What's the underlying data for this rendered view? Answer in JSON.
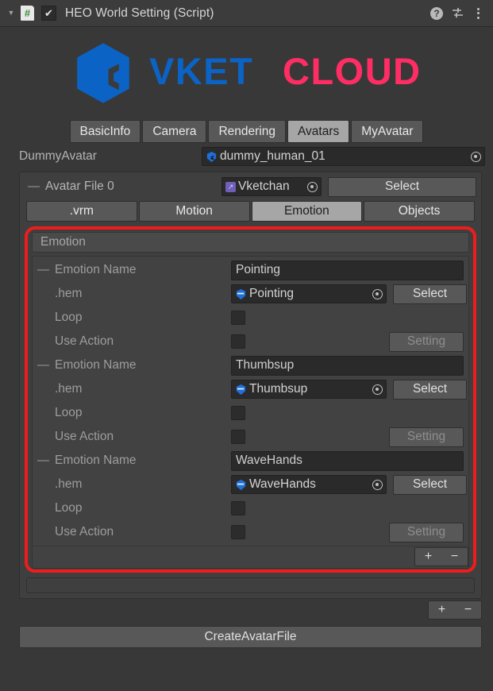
{
  "header": {
    "title": "HEO World Setting (Script)",
    "foldout_glyph": "▼",
    "script_icon_glyph": "#",
    "enabled_check_glyph": "✔",
    "help_glyph": "?"
  },
  "logo": {
    "brand_first": "VKET",
    "brand_second": "CLOUD",
    "blue": "#0B63C6",
    "pink": "#FF2D63"
  },
  "tabs": [
    {
      "label": "BasicInfo",
      "selected": false
    },
    {
      "label": "Camera",
      "selected": false
    },
    {
      "label": "Rendering",
      "selected": false
    },
    {
      "label": "Avatars",
      "selected": true
    },
    {
      "label": "MyAvatar",
      "selected": false
    }
  ],
  "dummy_avatar": {
    "label": "DummyAvatar",
    "value": "dummy_human_01"
  },
  "avatar_file": {
    "label": "Avatar File 0",
    "object_value": "Vketchan",
    "select_label": "Select"
  },
  "subtabs": [
    {
      "label": ".vrm",
      "selected": false
    },
    {
      "label": "Motion",
      "selected": false
    },
    {
      "label": "Emotion",
      "selected": true
    },
    {
      "label": "Objects",
      "selected": false
    }
  ],
  "emotion_section": {
    "title": "Emotion",
    "row_labels": {
      "name": "Emotion Name",
      "hem": ".hem",
      "loop": "Loop",
      "use_action": "Use Action"
    },
    "select_label": "Select",
    "setting_label": "Setting",
    "add_label": "+",
    "remove_label": "−",
    "highlight_color": "#ee1c1c",
    "entries": [
      {
        "name": "Pointing",
        "hem": "Pointing",
        "loop": false,
        "use_action": false
      },
      {
        "name": "Thumbsup",
        "hem": "Thumbsup",
        "loop": false,
        "use_action": false
      },
      {
        "name": "WaveHands",
        "hem": "WaveHands",
        "loop": false,
        "use_action": false
      }
    ]
  },
  "footer": {
    "add_label": "+",
    "remove_label": "−",
    "create_label": "CreateAvatarFile"
  }
}
